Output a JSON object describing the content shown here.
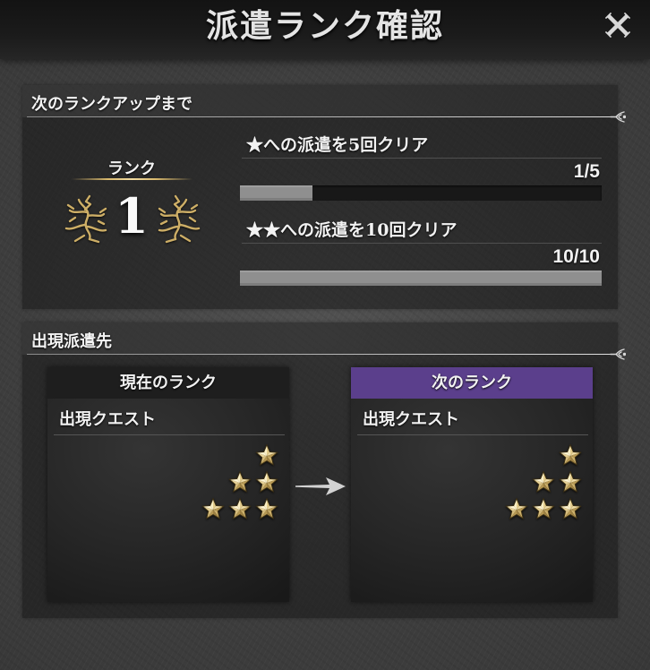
{
  "window": {
    "title": "派遣ランク確認",
    "close_icon": "close-icon"
  },
  "rankup": {
    "header": "次のランクアップまで",
    "rank_label": "ランク",
    "rank_value": "1",
    "conditions": [
      {
        "label": "★への派遣を5回クリア",
        "progress_text": "1/5",
        "current": 1,
        "total": 5
      },
      {
        "label": "★★への派遣を10回クリア",
        "progress_text": "10/10",
        "current": 10,
        "total": 10
      }
    ]
  },
  "appearance": {
    "header": "出現派遣先",
    "current_rank": {
      "header": "現在のランク",
      "subheader": "出現クエスト",
      "quest_star_levels": [
        1,
        2,
        3
      ]
    },
    "next_rank": {
      "header": "次のランク",
      "subheader": "出現クエスト",
      "quest_star_levels": [
        1,
        2,
        3
      ]
    }
  },
  "icons": {
    "close": "close-icon",
    "star": "star-icon",
    "arrow": "arrow-right-icon",
    "rank_emblem": "rank-emblem-icon",
    "divider_ornament": "leaf-ornament-icon"
  },
  "colors": {
    "title_bar": "#1b1b1b",
    "current_rank_header": "#1e1e1e",
    "next_rank_header": "#5b3f8c",
    "progress_fill": "#8f8f8f",
    "progress_track": "#181818",
    "emblem_gold": "#cdae66"
  }
}
